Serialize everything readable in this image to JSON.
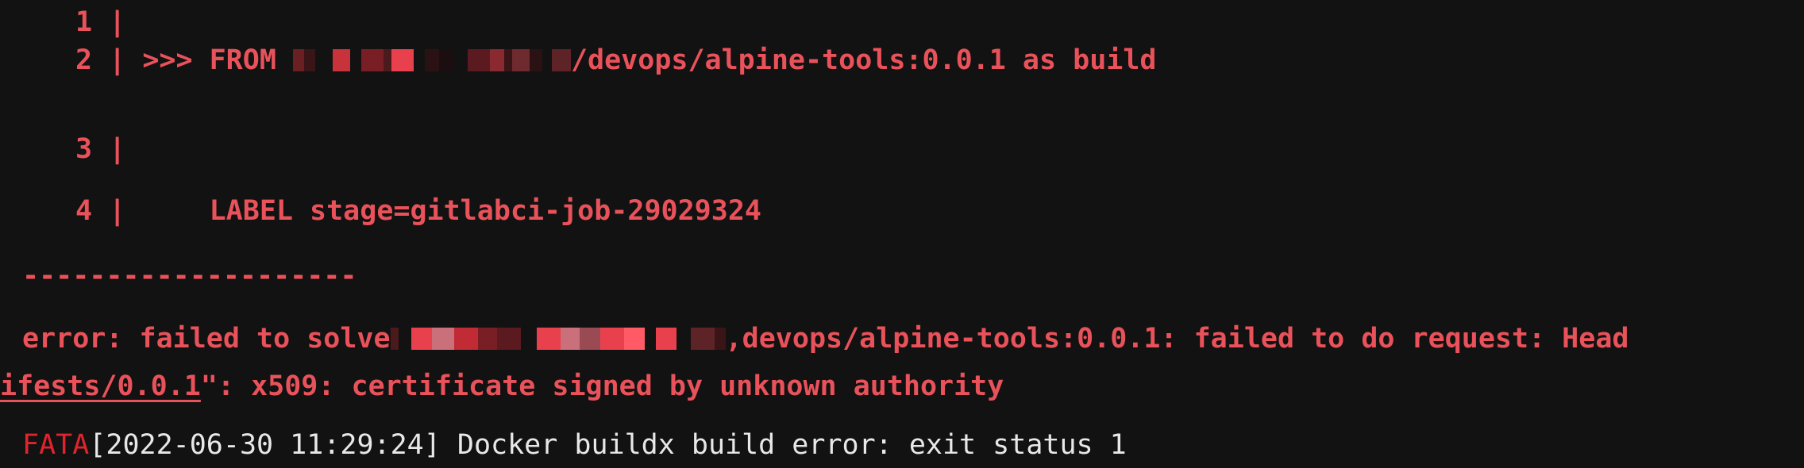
{
  "code_lines": [
    {
      "num": "1",
      "sep": "|",
      "text": ""
    },
    {
      "num": "2",
      "sep": "|",
      "prefix": ">>> FROM ",
      "suffix": "/devops/alpine-tools:0.0.1 as build"
    },
    {
      "num": "3",
      "sep": "|",
      "text": ""
    },
    {
      "num": "4",
      "sep": "|",
      "text": "    LABEL stage=gitlabci-job-29029324"
    }
  ],
  "divider": "--------------------",
  "error": {
    "prefix": "error: failed to solve",
    "suffix": ",devops/alpine-tools:0.0.1: failed to do request: Head",
    "cont_link": "ifests/0.0.1",
    "cont_rest": "\": x509: certificate signed by unknown authority"
  },
  "fatal": {
    "level": "FATA",
    "message": "[2022-06-30 11:29:24] Docker buildx build error: exit status 1"
  },
  "colors": {
    "background": "#121212",
    "error_text": "#e9525a",
    "fata": "#e0242d",
    "plain_text": "#e8e8e8"
  }
}
